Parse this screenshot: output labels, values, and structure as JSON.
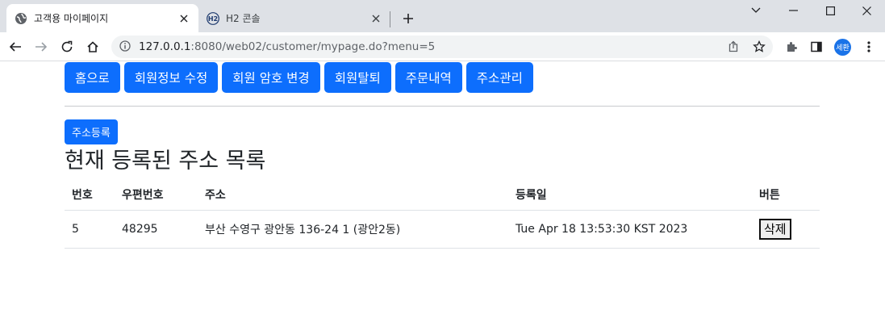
{
  "browser": {
    "tabs": [
      {
        "title": "고객용 마이페이지",
        "favicon": "globe-icon"
      },
      {
        "title": "H2 콘솔",
        "favicon": "h2-icon"
      }
    ],
    "url_host": "127.0.0.1",
    "url_rest": ":8080/web02/customer/mypage.do?menu=5",
    "profile_initials": "세환"
  },
  "nav": {
    "home": "홈으로",
    "edit_info": "회원정보 수정",
    "change_password": "회원 암호 변경",
    "withdraw": "회원탈퇴",
    "orders": "주문내역",
    "address_manage": "주소관리"
  },
  "page": {
    "register_button": "주소등록",
    "heading": "현재 등록된 주소 목록"
  },
  "table": {
    "headers": {
      "no": "번호",
      "zip": "우편번호",
      "address": "주소",
      "date": "등록일",
      "button": "버튼"
    },
    "rows": [
      {
        "no": "5",
        "zip": "48295",
        "address": "부산 수영구 광안동 136-24 1 (광안2동)",
        "date": "Tue Apr 18 13:53:30 KST 2023",
        "button": "삭제"
      }
    ]
  },
  "colors": {
    "primary": "#0d6efd",
    "tabstrip": "#dee1e6",
    "omnibox": "#f1f3f4"
  }
}
